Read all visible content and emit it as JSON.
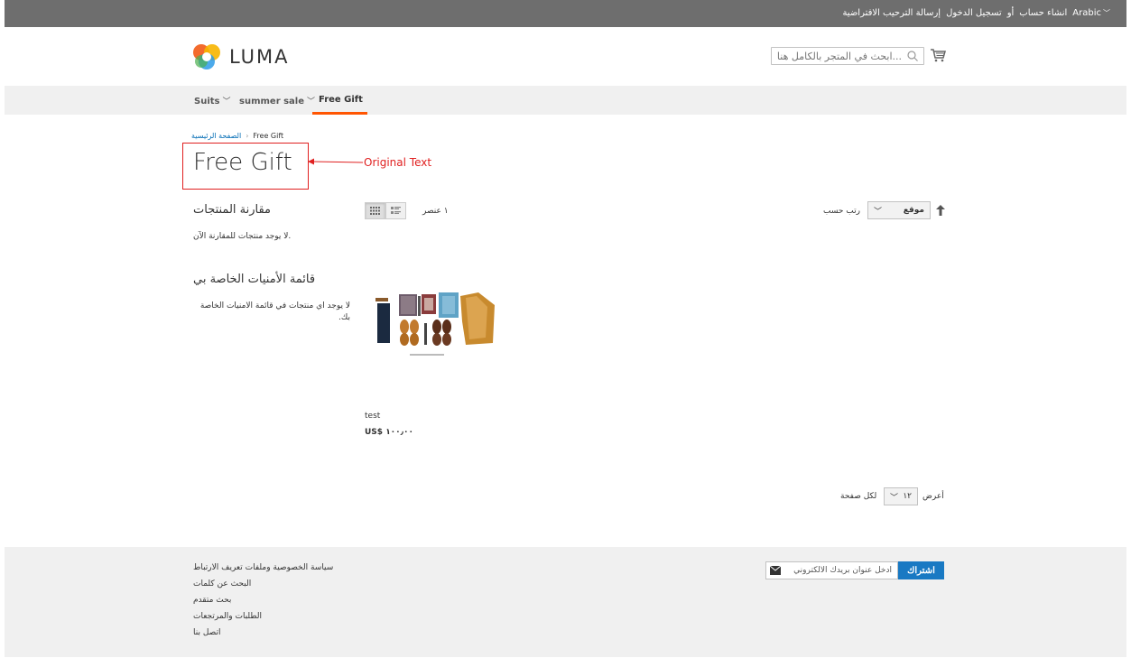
{
  "topbar": {
    "language": "Arabic",
    "create_account": "انشاء حساب",
    "or": "أو",
    "sign_in": "تسجيل الدخول",
    "welcome": "إرسالة الترحيب الافتراضية"
  },
  "header": {
    "logo_text": "LUMA",
    "search_placeholder": "...ابحث في المتجر بالكامل هنا"
  },
  "nav": {
    "items": [
      {
        "label": "Suits"
      },
      {
        "label": "summer sale"
      },
      {
        "label": "Free Gift"
      }
    ]
  },
  "breadcrumb": {
    "home": "الصفحة الرئيسية",
    "separator": "›",
    "current": "Free Gift"
  },
  "page": {
    "title": "Free Gift",
    "annotation": "Original Text"
  },
  "sidebar": {
    "compare_title": "مقارنة المنتجات",
    "compare_empty": ".لا يوجد منتجات للمقارنة الآن",
    "wishlist_title": "قائمة الأمنيات الخاصة بي",
    "wishlist_empty": "لا يوجد اي منتجات في قائمة الامنيات الخاصة بك."
  },
  "toolbar": {
    "count": "١ عنصر",
    "sort_label": "رتب حسب",
    "sort_value": "موقع",
    "limiter_show": "أعرض",
    "limiter_value": "١٢",
    "limiter_per_page": "لكل صفحة"
  },
  "product": {
    "name": "test",
    "price": "US$ ١٠٠٫٠٠"
  },
  "footer": {
    "links": [
      "سياسة الخصوصية وملفات تعريف الارتباط",
      "البحث عن كلمات",
      "بحث متقدم",
      "الطلبات والمرتجعات",
      "اتصل بنا"
    ],
    "newsletter_placeholder": "ادخل عنوان بريدك الالكتروني",
    "subscribe_label": "اشتراك"
  },
  "colors": {
    "accent": "#ff5501",
    "link": "#006bb4",
    "button": "#1979c3",
    "annotation": "#e02020"
  }
}
